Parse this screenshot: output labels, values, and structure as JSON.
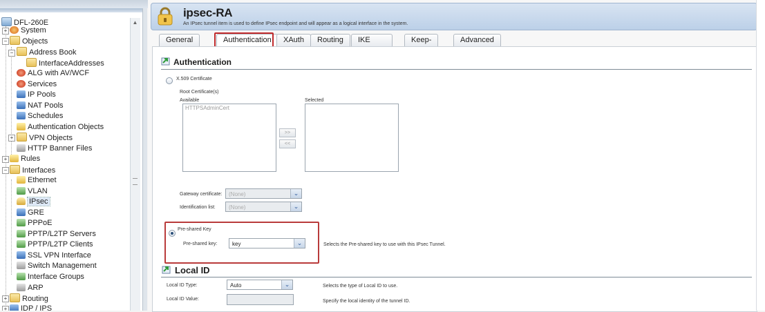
{
  "tree": {
    "items": [
      {
        "label": "DFL-260E",
        "icon": "device-icon"
      },
      {
        "label": "System",
        "icon": "system-icon"
      },
      {
        "label": "Objects",
        "icon": "folder-icon"
      },
      {
        "label": "Address Book",
        "icon": "address-book-icon"
      },
      {
        "label": "InterfaceAddresses",
        "icon": "folder-icon"
      },
      {
        "label": "ALG with AV/WCF",
        "icon": "alg-icon"
      },
      {
        "label": "Services",
        "icon": "services-icon"
      },
      {
        "label": "IP Pools",
        "icon": "ip-pools-icon"
      },
      {
        "label": "NAT Pools",
        "icon": "nat-pools-icon"
      },
      {
        "label": "Schedules",
        "icon": "schedules-icon"
      },
      {
        "label": "Authentication Objects",
        "icon": "authentication-objects-icon"
      },
      {
        "label": "VPN Objects",
        "icon": "folder-icon"
      },
      {
        "label": "HTTP Banner Files",
        "icon": "file-icon"
      },
      {
        "label": "Rules",
        "icon": "rules-icon"
      },
      {
        "label": "Interfaces",
        "icon": "folder-icon"
      },
      {
        "label": "Ethernet",
        "icon": "ethernet-icon"
      },
      {
        "label": "VLAN",
        "icon": "vlan-icon"
      },
      {
        "label": "IPsec",
        "icon": "lock-icon"
      },
      {
        "label": "GRE",
        "icon": "gre-icon"
      },
      {
        "label": "PPPoE",
        "icon": "pppoe-icon"
      },
      {
        "label": "PPTP/L2TP Servers",
        "icon": "pptp-server-icon"
      },
      {
        "label": "PPTP/L2TP Clients",
        "icon": "pptp-client-icon"
      },
      {
        "label": "SSL VPN Interface",
        "icon": "ssl-vpn-icon"
      },
      {
        "label": "Switch Management",
        "icon": "switch-icon"
      },
      {
        "label": "Interface Groups",
        "icon": "interface-groups-icon"
      },
      {
        "label": "ARP",
        "icon": "arp-icon"
      },
      {
        "label": "Routing",
        "icon": "folder-icon"
      },
      {
        "label": "IDP / IPS",
        "icon": "idp-icon"
      }
    ]
  },
  "header": {
    "title": "ipsec-RA",
    "subtitle": "An IPsec tunnel item is used to define IPsec endpoint and will appear as a logical interface in the system."
  },
  "tabs": [
    "General",
    "Authentication",
    "XAuth",
    "Routing",
    "IKE Settings",
    "Keep-alive",
    "Advanced"
  ],
  "authentication": {
    "title": "Authentication",
    "x509_label": "X.509 Certificate",
    "root_cert_label": "Root Certificate(s)",
    "available_label": "Available",
    "selected_label": "Selected",
    "available_items": [
      "HTTPSAdminCert"
    ],
    "add_button": ">>",
    "remove_button": "<<",
    "gateway_cert_label": "Gateway certificate:",
    "gateway_cert_value": "(None)",
    "identification_list_label": "Identification list:",
    "identification_list_value": "(None)",
    "psk_option_label": "Pre-shared Key",
    "psk_field_label": "Pre-shared key:",
    "psk_value": "key",
    "psk_help": "Selects the Pre-shared key to use with this IPsec Tunnel."
  },
  "local_id": {
    "title": "Local ID",
    "type_label": "Local ID Type:",
    "type_value": "Auto",
    "type_help": "Selects the type of Local ID to use.",
    "value_label": "Local ID Value:",
    "value_help": "Specify the local identity of the tunnel ID."
  },
  "colors": {
    "highlight": "#c0292b",
    "header_bg": "#c9dbee"
  }
}
